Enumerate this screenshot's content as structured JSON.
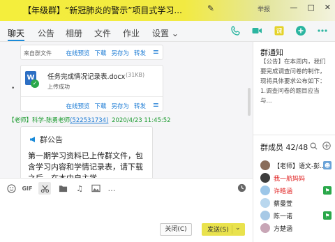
{
  "window": {
    "title": "【年级群】“新冠肺炎的警示”项目式学习...",
    "report_label": "举报"
  },
  "tabs": [
    {
      "label": "聊天",
      "active": true
    },
    {
      "label": "公告"
    },
    {
      "label": "相册"
    },
    {
      "label": "文件"
    },
    {
      "label": "作业"
    },
    {
      "label": "设置 ⌄"
    }
  ],
  "toolbar_icons": [
    "phone-icon",
    "video-icon",
    "class-icon",
    "add-icon",
    "more-icon"
  ],
  "colors": {
    "accent": "#1a8ad8",
    "green": "#1a9a2e",
    "title_yellow": "#f4ee3c",
    "send_yellow": "#e9e24d"
  },
  "chat": {
    "file_card_1": {
      "from": "来自群文件",
      "actions": [
        "在线预览",
        "下载",
        "另存为",
        "转发"
      ]
    },
    "file_card_2": {
      "file_name": "任务完成情况记录表.docx",
      "file_size": "(31KB)",
      "status": "上传成功",
      "actions": [
        "在线预览",
        "下载",
        "另存为",
        "转发"
      ],
      "file_icon_letter": "W"
    },
    "message": {
      "role": "【老师】",
      "sender": "科学-陈勇老师",
      "qq": "(522531734)",
      "time": "2020/4/23 11:45:52"
    },
    "notice_card": {
      "header": "群公告",
      "body": "第一期学习资料已上传群文件，包含学习内容和学情记录表，请下载之后，在本中自主学"
    }
  },
  "compose": {
    "close_label": "关闭(C)",
    "send_label": "发送(S)"
  },
  "sidebar": {
    "notice_title": "群通知",
    "notice_text": "【公告】在本周内，我们要完成调查问卷的制作，现将具体要求公布如下：1.调查问卷的题目应当与...",
    "members_title": "群成员 42/48",
    "members": [
      {
        "name": "【老师】语文-彭...",
        "color": "#222",
        "badge": "person-icon",
        "badge_color": "#6aa3d8"
      },
      {
        "name": "我一航妈妈",
        "color": "#e02020",
        "badge": "",
        "badge_color": ""
      },
      {
        "name": "许皓涵",
        "color": "#e02020",
        "badge": "flag-icon",
        "badge_color": "#2aa84a"
      },
      {
        "name": "蔡曼萱",
        "color": "#222",
        "badge": "",
        "badge_color": ""
      },
      {
        "name": "陈一诺",
        "color": "#222",
        "badge": "flag-icon",
        "badge_color": "#2aa84a"
      },
      {
        "name": "方楚涵",
        "color": "#222",
        "badge": "",
        "badge_color": ""
      }
    ]
  }
}
